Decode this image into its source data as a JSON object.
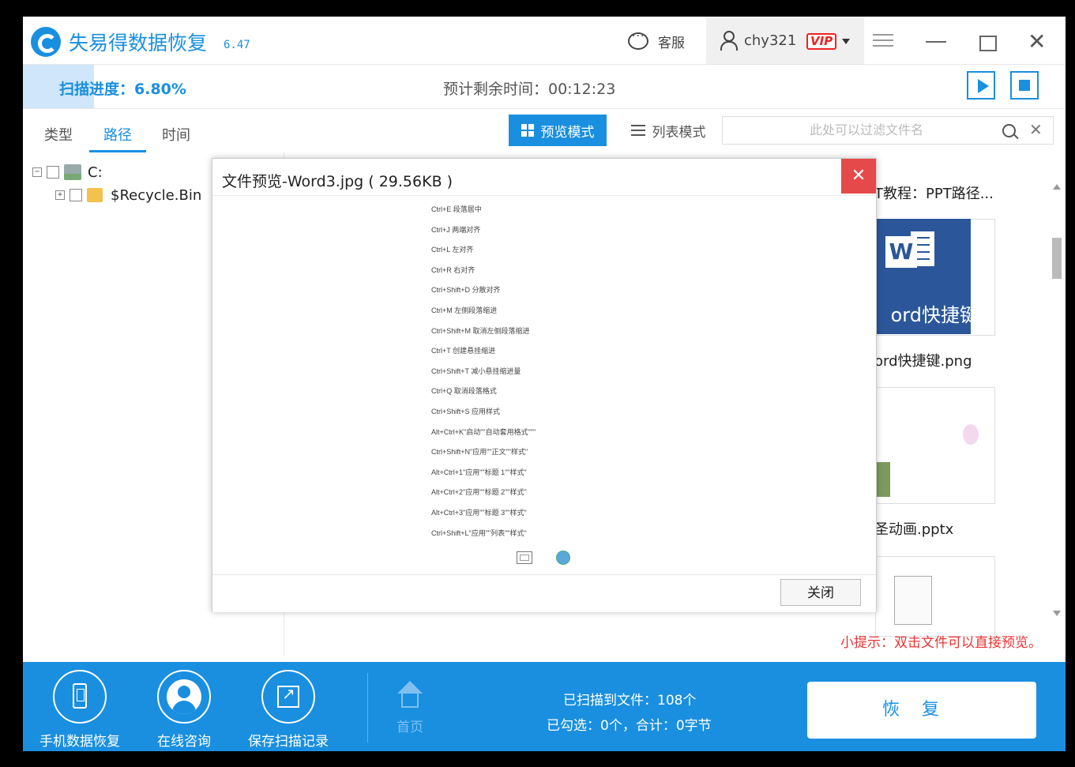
{
  "title_bar": {
    "app_name": "失易得数据恢复",
    "version": "6.47",
    "service_label": "客服",
    "username": "chy321",
    "vip_label": "VIP"
  },
  "scan": {
    "progress_label": "扫描进度：6.80%",
    "progress_value": 6.8,
    "remaining_label": "预计剩余时间：00:12:23"
  },
  "tabs": [
    {
      "label": "类型",
      "active": false
    },
    {
      "label": "路径",
      "active": true
    },
    {
      "label": "时间",
      "active": false
    }
  ],
  "view_modes": {
    "preview_label": "预览模式",
    "list_label": "列表模式"
  },
  "filter": {
    "placeholder": "此处可以过滤文件名",
    "value": ""
  },
  "tree": {
    "drive_label": "C:",
    "folder_label": "$Recycle.Bin"
  },
  "files": {
    "item1_label": "T教程：PPT路径...",
    "item2_label": "ord快捷键.png",
    "item2_thumb_text": "ord快捷键",
    "item3_label": "圣动画.pptx"
  },
  "hint": "小提示：双击文件可以直接预览。",
  "dialog": {
    "title": "文件预览-Word3.jpg ( 29.56KB )",
    "close_x": "✕",
    "close_button": "关闭",
    "shortcuts": [
      "Ctrl+E 段落居中",
      "Ctrl+J 两端对齐",
      "Ctrl+L 左对齐",
      "Ctrl+R 右对齐",
      "Ctrl+Shift+D 分散对齐",
      "Ctrl+M 左侧段落缩进",
      "Ctrl+Shift+M 取消左侧段落缩进",
      "Ctrl+T 创建悬挂缩进",
      "Ctrl+Shift+T 减小悬挂缩进量",
      "Ctrl+Q 取消段落格式",
      "Ctrl+Shift+S 应用样式",
      "Alt+Ctrl+K\"启动\"\"自动套用格式\"\"\"",
      "Ctrl+Shift+N\"应用\"\"正文\"\"样式\"",
      "Alt+Ctrl+1\"应用\"\"标题 1\"\"样式\"",
      "Alt+Ctrl+2\"应用\"\"标题 2\"\"样式\"",
      "Alt+Ctrl+3\"应用\"\"标题 3\"\"样式\"",
      "Ctrl+Shift+L\"应用\"\"列表\"\"样式\""
    ]
  },
  "bottom": {
    "phone_recovery": "手机数据恢复",
    "online_consult": "在线咨询",
    "save_scan": "保存扫描记录",
    "home": "首页",
    "scanned_files": "已扫描到文件：108个",
    "selected_summary": "已勾选：0个，合计：0字节",
    "recover_button": "恢复"
  },
  "colors": {
    "accent": "#1a8fe0",
    "danger": "#e6494a",
    "hint": "#e33333"
  }
}
